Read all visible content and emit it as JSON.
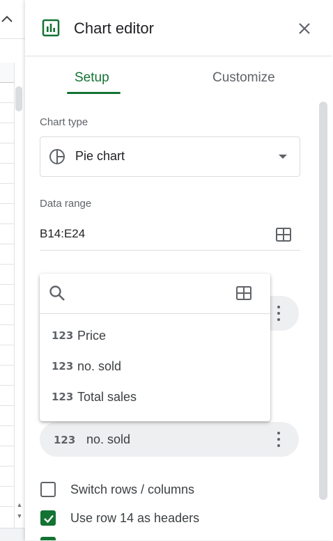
{
  "panel": {
    "title": "Chart editor",
    "tabs": [
      "Setup",
      "Customize"
    ],
    "active_tab": "Setup"
  },
  "chart_type": {
    "label": "Chart type",
    "value": "Pie chart"
  },
  "data_range": {
    "label": "Data range",
    "value": "B14:E24"
  },
  "column_picker": {
    "search_placeholder": "",
    "options": [
      {
        "type_icon": "123",
        "label": "Price"
      },
      {
        "type_icon": "123",
        "label": "no. sold"
      },
      {
        "type_icon": "123",
        "label": "Total sales"
      }
    ]
  },
  "value_chip": {
    "type_icon": "123",
    "label": "no. sold"
  },
  "checkboxes": [
    {
      "label": "Switch rows / columns",
      "checked": false
    },
    {
      "label": "Use row 14 as headers",
      "checked": true
    }
  ],
  "colors": {
    "accent": "#137333",
    "text": "#3c4043",
    "chip_bg": "#eeeff1"
  }
}
